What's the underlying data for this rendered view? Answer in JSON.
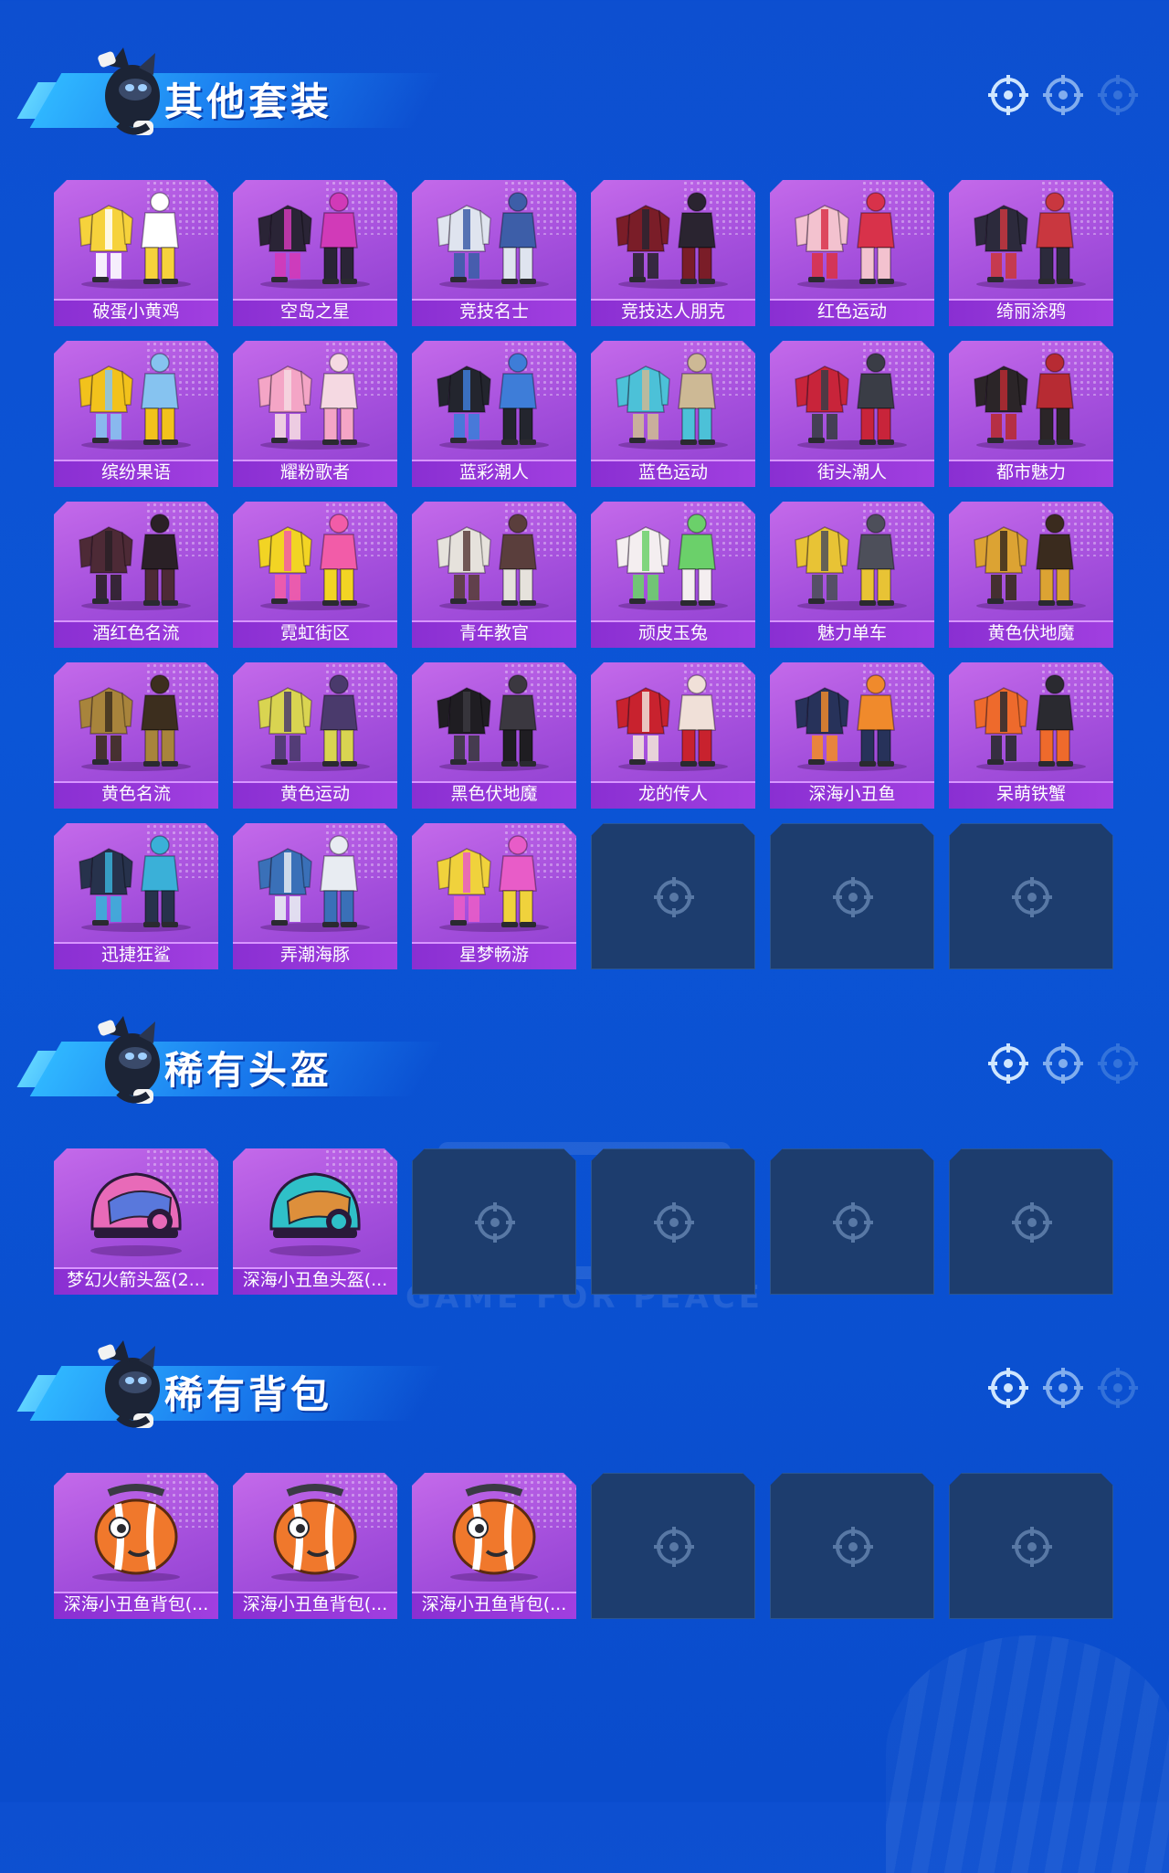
{
  "sections": [
    {
      "title": "其他套装",
      "items": [
        {
          "label": "破蛋小黄鸡",
          "art": "outfit",
          "c1": "#f6d23c",
          "c2": "#ffffff"
        },
        {
          "label": "空岛之星",
          "art": "outfit",
          "c1": "#2a2436",
          "c2": "#d13ab8"
        },
        {
          "label": "竞技名士",
          "art": "outfit",
          "c1": "#dfe4ef",
          "c2": "#3d5ea8"
        },
        {
          "label": "竞技达人朋克",
          "art": "outfit",
          "c1": "#7a1d28",
          "c2": "#2a2430"
        },
        {
          "label": "红色运动",
          "art": "outfit",
          "c1": "#f3c2cf",
          "c2": "#d8324a"
        },
        {
          "label": "绮丽涂鸦",
          "art": "outfit",
          "c1": "#2c2a3c",
          "c2": "#c9373f"
        },
        {
          "label": "缤纷果语",
          "art": "outfit",
          "c1": "#f2c21c",
          "c2": "#86c3f0"
        },
        {
          "label": "耀粉歌者",
          "art": "outfit",
          "c1": "#f4a5c6",
          "c2": "#f5d9e2"
        },
        {
          "label": "蓝彩潮人",
          "art": "outfit",
          "c1": "#23252e",
          "c2": "#3e7dd8"
        },
        {
          "label": "蓝色运动",
          "art": "outfit",
          "c1": "#4cc1d8",
          "c2": "#cdb995"
        },
        {
          "label": "街头潮人",
          "art": "outfit",
          "c1": "#c8243a",
          "c2": "#3a3d46"
        },
        {
          "label": "都市魅力",
          "art": "outfit",
          "c1": "#2b2528",
          "c2": "#b72b33"
        },
        {
          "label": "酒红色名流",
          "art": "outfit",
          "c1": "#4d2a36",
          "c2": "#2a2026"
        },
        {
          "label": "霓虹街区",
          "art": "outfit",
          "c1": "#f2d424",
          "c2": "#f25ca8"
        },
        {
          "label": "青年教官",
          "art": "outfit",
          "c1": "#e6e2dc",
          "c2": "#5a3e3c"
        },
        {
          "label": "顽皮玉兔",
          "art": "outfit",
          "c1": "#f4eef0",
          "c2": "#6bd06a"
        },
        {
          "label": "魅力单车",
          "art": "outfit",
          "c1": "#e8c335",
          "c2": "#4d4f5a"
        },
        {
          "label": "黄色伏地魔",
          "art": "outfit",
          "c1": "#dca333",
          "c2": "#3a2b1e"
        },
        {
          "label": "黄色名流",
          "art": "outfit",
          "c1": "#a8843c",
          "c2": "#3c2e1e"
        },
        {
          "label": "黄色运动",
          "art": "outfit",
          "c1": "#d9d451",
          "c2": "#4a3a6c"
        },
        {
          "label": "黑色伏地魔",
          "art": "outfit",
          "c1": "#1f1d22",
          "c2": "#3b3840"
        },
        {
          "label": "龙的传人",
          "art": "outfit",
          "c1": "#c8222e",
          "c2": "#f0e0d8"
        },
        {
          "label": "深海小丑鱼",
          "art": "outfit",
          "c1": "#27325a",
          "c2": "#f08a2c"
        },
        {
          "label": "呆萌铁蟹",
          "art": "outfit",
          "c1": "#ee6a2c",
          "c2": "#2a2a30"
        },
        {
          "label": "迅捷狂鲨",
          "art": "outfit",
          "c1": "#27324c",
          "c2": "#3ab0d8"
        },
        {
          "label": "弄潮海豚",
          "art": "outfit",
          "c1": "#3a70b8",
          "c2": "#e8ecf2"
        },
        {
          "label": "星梦畅游",
          "art": "outfit",
          "c1": "#f0d23c",
          "c2": "#e85cc8"
        }
      ],
      "slots": 30
    },
    {
      "title": "稀有头盔",
      "items": [
        {
          "label": "梦幻火箭头盔(2...",
          "art": "helmet",
          "c1": "#e86ab8",
          "c2": "#4a7ae0"
        },
        {
          "label": "深海小丑鱼头盔(...",
          "art": "helmet",
          "c1": "#2fc0c8",
          "c2": "#f08a2c"
        }
      ],
      "slots": 6
    },
    {
      "title": "稀有背包",
      "items": [
        {
          "label": "深海小丑鱼背包(...",
          "art": "backpack",
          "c1": "#f0782c",
          "c2": "#ffffff"
        },
        {
          "label": "深海小丑鱼背包(...",
          "art": "backpack",
          "c1": "#f0782c",
          "c2": "#ffffff"
        },
        {
          "label": "深海小丑鱼背包(...",
          "art": "backpack",
          "c1": "#f0782c",
          "c2": "#ffffff"
        }
      ],
      "slots": 6
    }
  ],
  "watermark": "GAME FOR PEACE"
}
